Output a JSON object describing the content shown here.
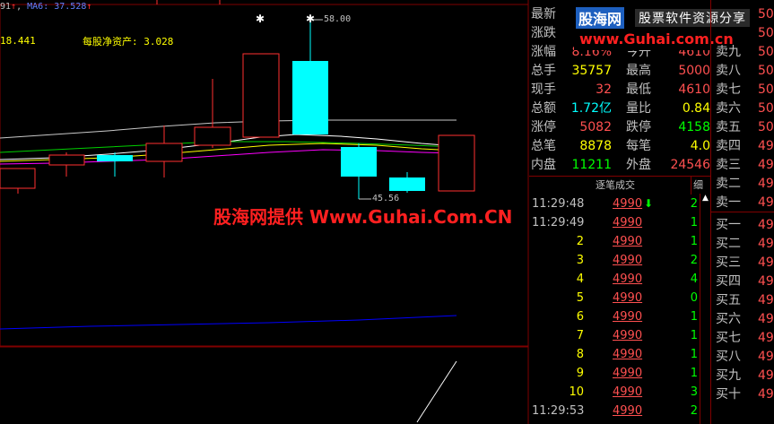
{
  "chart": {
    "ma_legend": {
      "prefix": "91",
      "ma_label": "MA6",
      "ma_value": "37.528"
    },
    "indicator_left": "18.441",
    "indicator_net_asset": "每股净资产: 3.028",
    "high_label": "58.00",
    "low_label": "45.56",
    "watermark": "股海网提供 Www.Guhai.Com.CN",
    "colors": {
      "up": "#ff3030",
      "down": "#00ffff",
      "ma1": "#ffffff",
      "ma2": "#ffff00",
      "ma3": "#ff00ff",
      "ma4": "#00ff00",
      "blue_line": "#0000ff",
      "frame": "#800000"
    }
  },
  "logo": {
    "brand": "股海网",
    "slogan": "股票软件资源分享",
    "url": "www.Guhai.com.cn"
  },
  "quote": [
    {
      "l1": "最新",
      "v1": "",
      "c1": "#ff5050",
      "l2": "",
      "v2": "",
      "c2": "#ff5050"
    },
    {
      "l1": "涨跌",
      "v1": "",
      "c1": "#ff5050",
      "l2": "",
      "v2": "",
      "c2": "#ff5050"
    },
    {
      "l1": "涨幅",
      "v1": "8.16%",
      "c1": "#ff5050",
      "l2": "今开",
      "v2": "4610",
      "c2": "#ff5050"
    },
    {
      "l1": "总手",
      "v1": "35757",
      "c1": "#ffff00",
      "l2": "最高",
      "v2": "5000",
      "c2": "#ff5050"
    },
    {
      "l1": "现手",
      "v1": "32",
      "c1": "#ff5050",
      "l2": "最低",
      "v2": "4610",
      "c2": "#ff5050"
    },
    {
      "l1": "总额",
      "v1": "1.72亿",
      "c1": "#00ffff",
      "l2": "量比",
      "v2": "0.84",
      "c2": "#ffff00"
    },
    {
      "l1": "涨停",
      "v1": "5082",
      "c1": "#ff5050",
      "l2": "跌停",
      "v2": "4158",
      "c2": "#00ff00"
    },
    {
      "l1": "总笔",
      "v1": "8878",
      "c1": "#ffff00",
      "l2": "每笔",
      "v2": "4.0",
      "c2": "#ffff00"
    },
    {
      "l1": "内盘",
      "v1": "11211",
      "c1": "#00ff00",
      "l2": "外盘",
      "v2": "24546",
      "c2": "#ff5050"
    }
  ],
  "ticks": {
    "header": "逐笔成交",
    "header_right": "细",
    "rows": [
      {
        "time": "11:29:48",
        "price": "4990",
        "arrow": "⬇",
        "vol": "2"
      },
      {
        "time": "11:29:49",
        "price": "4990",
        "arrow": "",
        "vol": "1"
      },
      {
        "time": "2",
        "price": "4990",
        "arrow": "",
        "vol": "1"
      },
      {
        "time": "3",
        "price": "4990",
        "arrow": "",
        "vol": "2"
      },
      {
        "time": "4",
        "price": "4990",
        "arrow": "",
        "vol": "4"
      },
      {
        "time": "5",
        "price": "4990",
        "arrow": "",
        "vol": "0"
      },
      {
        "time": "6",
        "price": "4990",
        "arrow": "",
        "vol": "1"
      },
      {
        "time": "7",
        "price": "4990",
        "arrow": "",
        "vol": "1"
      },
      {
        "time": "8",
        "price": "4990",
        "arrow": "",
        "vol": "1"
      },
      {
        "time": "9",
        "price": "4990",
        "arrow": "",
        "vol": "1"
      },
      {
        "time": "10",
        "price": "4990",
        "arrow": "",
        "vol": "3"
      },
      {
        "time": "11:29:53",
        "price": "4990",
        "arrow": "",
        "vol": "2"
      }
    ]
  },
  "book": {
    "rows": [
      {
        "label": "",
        "price": "50"
      },
      {
        "label": "",
        "price": "50"
      },
      {
        "label": "卖九",
        "price": "50"
      },
      {
        "label": "卖八",
        "price": "50"
      },
      {
        "label": "卖七",
        "price": "50"
      },
      {
        "label": "卖六",
        "price": "50"
      },
      {
        "label": "卖五",
        "price": "50"
      },
      {
        "label": "卖四",
        "price": "49"
      },
      {
        "label": "卖三",
        "price": "49"
      },
      {
        "label": "卖二",
        "price": "49"
      },
      {
        "label": "卖一",
        "price": "49"
      },
      {
        "label": "买一",
        "price": "49"
      },
      {
        "label": "买二",
        "price": "49"
      },
      {
        "label": "买三",
        "price": "49"
      },
      {
        "label": "买四",
        "price": "49"
      },
      {
        "label": "买五",
        "price": "49"
      },
      {
        "label": "买六",
        "price": "49"
      },
      {
        "label": "买七",
        "price": "49"
      },
      {
        "label": "买八",
        "price": "49"
      },
      {
        "label": "买九",
        "price": "49"
      },
      {
        "label": "买十",
        "price": "49"
      }
    ]
  }
}
